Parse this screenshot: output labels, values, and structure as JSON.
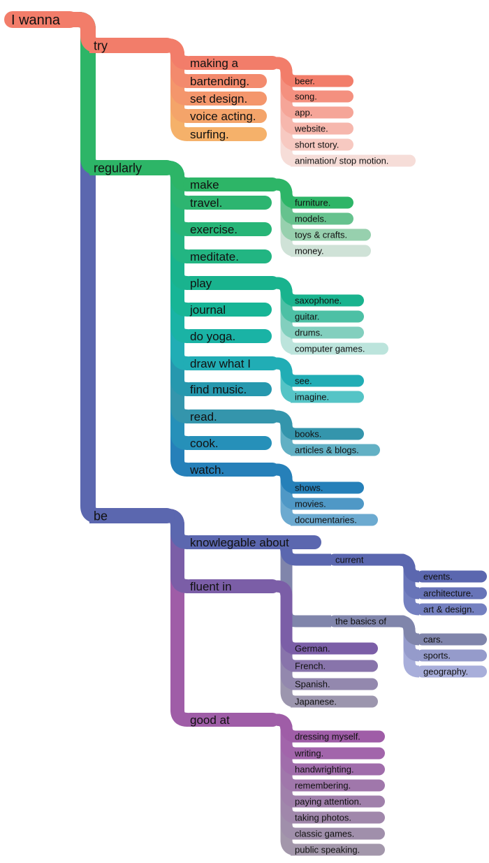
{
  "title": "I wanna",
  "root": {
    "label": "I wanna",
    "color": "#F27D6A",
    "children": [
      {
        "label": "try",
        "color": "#F27D6A",
        "children": [
          {
            "label": "making a",
            "color": "#F27D6A",
            "children": [
              {
                "label": "beer.",
                "color": "#F27D6A"
              },
              {
                "label": "song.",
                "color": "#F4907F"
              },
              {
                "label": "app.",
                "color": "#F5A598"
              },
              {
                "label": "website.",
                "color": "#F6B7AD"
              },
              {
                "label": "short story.",
                "color": "#F7C9C1"
              },
              {
                "label": "animation/ stop motion.",
                "color": "#F6DDD8"
              }
            ]
          },
          {
            "label": "bartending.",
            "color": "#F38A6D"
          },
          {
            "label": "set design.",
            "color": "#F4966C"
          },
          {
            "label": "voice acting.",
            "color": "#F4A46A"
          },
          {
            "label": "surfing.",
            "color": "#F5B16A"
          }
        ]
      },
      {
        "label": "regularly",
        "color": "#2DB567",
        "children": [
          {
            "label": "make",
            "color": "#2DB567",
            "children": [
              {
                "label": "furniture.",
                "color": "#2DB567"
              },
              {
                "label": "models.",
                "color": "#66C28E"
              },
              {
                "label": "toys & crafts.",
                "color": "#97D0AE"
              },
              {
                "label": "money.",
                "color": "#CFE2D7"
              }
            ]
          },
          {
            "label": "travel.",
            "color": "#2DB570"
          },
          {
            "label": "exercise.",
            "color": "#27B577"
          },
          {
            "label": "meditate.",
            "color": "#22B582"
          },
          {
            "label": "play",
            "color": "#19B38E",
            "children": [
              {
                "label": "saxophone.",
                "color": "#19B38E"
              },
              {
                "label": "guitar.",
                "color": "#4DC0A5"
              },
              {
                "label": "drums.",
                "color": "#82CFBE"
              },
              {
                "label": "computer games.",
                "color": "#BCE4DC"
              }
            ]
          },
          {
            "label": "journal",
            "color": "#17B596"
          },
          {
            "label": "do yoga.",
            "color": "#1AB3A5"
          },
          {
            "label": "draw what I",
            "color": "#21ADB5",
            "children": [
              {
                "label": "see.",
                "color": "#21ADB5"
              },
              {
                "label": "imagine.",
                "color": "#55C4C6"
              }
            ]
          },
          {
            "label": "find music.",
            "color": "#2698AE"
          },
          {
            "label": "read.",
            "color": "#3495AC",
            "children": [
              {
                "label": "books.",
                "color": "#3495AC"
              },
              {
                "label": "articles & blogs.",
                "color": "#62B0C4"
              }
            ]
          },
          {
            "label": "cook.",
            "color": "#2690B9"
          },
          {
            "label": "watch.",
            "color": "#2680B9",
            "children": [
              {
                "label": "shows.",
                "color": "#2680B9"
              },
              {
                "label": "movies.",
                "color": "#4F98C6"
              },
              {
                "label": "documentaries.",
                "color": "#6CAAD0"
              }
            ]
          }
        ]
      },
      {
        "label": "be",
        "color": "#5B67AF",
        "children": [
          {
            "label": "knowlegable about",
            "color": "#5B67AF",
            "children": [
              {
                "label": "current",
                "color": "#5B67AF",
                "children": [
                  {
                    "label": "events.",
                    "color": "#5B67AF"
                  },
                  {
                    "label": "architecture.",
                    "color": "#6874B8"
                  },
                  {
                    "label": "art & design.",
                    "color": "#7480C0"
                  }
                ]
              },
              {
                "label": "the basics of",
                "color": "#8085AB",
                "children": [
                  {
                    "label": "cars.",
                    "color": "#8085AB"
                  },
                  {
                    "label": "sports.",
                    "color": "#959BCB"
                  },
                  {
                    "label": "geography.",
                    "color": "#A8AEDA"
                  }
                ]
              }
            ]
          },
          {
            "label": "fluent in",
            "color": "#7B5EA7",
            "children": [
              {
                "label": "German.",
                "color": "#7B5EA7"
              },
              {
                "label": "French.",
                "color": "#8874AB"
              },
              {
                "label": "Spanish.",
                "color": "#9388AE"
              },
              {
                "label": "Japanese.",
                "color": "#9C96AE"
              }
            ]
          },
          {
            "label": "good at",
            "color": "#9F5DA7",
            "children": [
              {
                "label": "dressing myself.",
                "color": "#9F5DA7"
              },
              {
                "label": "writing.",
                "color": "#A265AB"
              },
              {
                "label": "handwrighting.",
                "color": "#A06DAB"
              },
              {
                "label": "remembering.",
                "color": "#A077AB"
              },
              {
                "label": "paying attention.",
                "color": "#A080AB"
              },
              {
                "label": "taking photos.",
                "color": "#A087AB"
              },
              {
                "label": "classic games.",
                "color": "#A08FAB"
              },
              {
                "label": "public speaking.",
                "color": "#A397AB"
              }
            ]
          }
        ]
      }
    ]
  }
}
